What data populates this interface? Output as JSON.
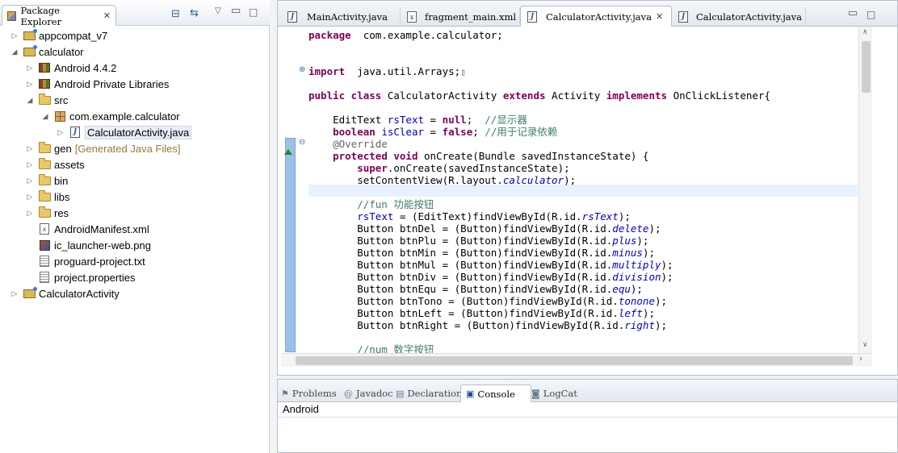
{
  "explorer": {
    "title": "Package Explorer",
    "tree": [
      {
        "label": "appcompat_v7",
        "icon": "project-icon",
        "arrow": "▷",
        "indent": 0
      },
      {
        "label": "calculator",
        "icon": "project-icon",
        "arrow": "◢",
        "indent": 0
      },
      {
        "label": "Android 4.4.2",
        "icon": "library-icon",
        "arrow": "▷",
        "indent": 1
      },
      {
        "label": "Android Private Libraries",
        "icon": "library-icon",
        "arrow": "▷",
        "indent": 1
      },
      {
        "label": "src",
        "icon": "src-folder-icon",
        "arrow": "◢",
        "indent": 1
      },
      {
        "label": "com.example.calculator",
        "icon": "package-icon",
        "arrow": "◢",
        "indent": 2
      },
      {
        "label": "CalculatorActivity.java",
        "icon": "java-file-icon",
        "arrow": "▷",
        "indent": 3,
        "selected": true
      },
      {
        "label": "gen",
        "suffix": "[Generated Java Files]",
        "icon": "folder-icon",
        "arrow": "▷",
        "indent": 1
      },
      {
        "label": "assets",
        "icon": "folder-icon",
        "arrow": "▷",
        "indent": 1
      },
      {
        "label": "bin",
        "icon": "folder-icon",
        "arrow": "▷",
        "indent": 1
      },
      {
        "label": "libs",
        "icon": "folder-icon",
        "arrow": "▷",
        "indent": 1
      },
      {
        "label": "res",
        "icon": "folder-icon",
        "arrow": "▷",
        "indent": 1
      },
      {
        "label": "AndroidManifest.xml",
        "icon": "xml-file-icon",
        "arrow": "",
        "indent": 1
      },
      {
        "label": "ic_launcher-web.png",
        "icon": "image-file-icon",
        "arrow": "",
        "indent": 1
      },
      {
        "label": "proguard-project.txt",
        "icon": "text-file-icon",
        "arrow": "",
        "indent": 1
      },
      {
        "label": "project.properties",
        "icon": "text-file-icon",
        "arrow": "",
        "indent": 1
      },
      {
        "label": "CalculatorActivity",
        "icon": "project-icon",
        "arrow": "▷",
        "indent": 0
      }
    ]
  },
  "editor": {
    "tabs": [
      {
        "label": "MainActivity.java",
        "icon": "java-file-icon"
      },
      {
        "label": "fragment_main.xml",
        "icon": "xml-file-icon"
      },
      {
        "label": "CalculatorActivity.java",
        "icon": "java-file-icon",
        "active": true
      },
      {
        "label": "CalculatorActivity.java",
        "icon": "java-file-icon"
      }
    ],
    "lines": [
      [
        [
          "kw",
          "package"
        ],
        [
          "",
          "  com.example.calculator;"
        ]
      ],
      [],
      [],
      [
        [
          "kw",
          "import"
        ],
        [
          "",
          "  java.util.Arrays;"
        ],
        [
          "box",
          "▯"
        ]
      ],
      [],
      [
        [
          "kw",
          "public class"
        ],
        [
          "",
          " CalculatorActivity "
        ],
        [
          "kw",
          "extends"
        ],
        [
          "",
          " Activity "
        ],
        [
          "kw",
          "implements"
        ],
        [
          "",
          " OnClickListener{"
        ]
      ],
      [],
      [
        [
          "",
          "    EditText "
        ],
        [
          "fld",
          "rsText"
        ],
        [
          "",
          " = "
        ],
        [
          "kw",
          "null"
        ],
        [
          "",
          ";  "
        ],
        [
          "cm",
          "//显示器"
        ]
      ],
      [
        [
          "",
          "    "
        ],
        [
          "kw",
          "boolean"
        ],
        [
          "",
          ""
        ],
        [
          "fld",
          " isClear"
        ],
        [
          "",
          " = "
        ],
        [
          "kw",
          "false"
        ],
        [
          "",
          "; "
        ],
        [
          "cm",
          "//用于记录依赖"
        ]
      ],
      [
        [
          "an",
          "    @Override"
        ]
      ],
      [
        [
          "",
          "    "
        ],
        [
          "kw",
          "protected void"
        ],
        [
          "",
          " onCreate(Bundle savedInstanceState) {"
        ]
      ],
      [
        [
          "",
          "        "
        ],
        [
          "kw",
          "super"
        ],
        [
          "",
          ".onCreate(savedInstanceState);"
        ]
      ],
      [
        [
          "",
          "        setContentView(R.layout."
        ],
        [
          "ifld",
          "calculator"
        ],
        [
          "",
          ");"
        ]
      ],
      [],
      [
        [
          "cm",
          "        //fun 功能按钮"
        ]
      ],
      [
        [
          "",
          "        "
        ],
        [
          "fld",
          "rsText"
        ],
        [
          "",
          " = (EditText)findViewById(R.id."
        ],
        [
          "ifld",
          "rsText"
        ],
        [
          "",
          ");"
        ]
      ],
      [
        [
          "",
          "        Button btnDel = (Button)findViewById(R.id."
        ],
        [
          "ifld",
          "delete"
        ],
        [
          "",
          ");"
        ]
      ],
      [
        [
          "",
          "        Button btnPlu = (Button)findViewById(R.id."
        ],
        [
          "ifld",
          "plus"
        ],
        [
          "",
          ");"
        ]
      ],
      [
        [
          "",
          "        Button btnMin = (Button)findViewById(R.id."
        ],
        [
          "ifld",
          "minus"
        ],
        [
          "",
          ");"
        ]
      ],
      [
        [
          "",
          "        Button btnMul = (Button)findViewById(R.id."
        ],
        [
          "ifld",
          "multiply"
        ],
        [
          "",
          ");"
        ]
      ],
      [
        [
          "",
          "        Button btnDiv = (Button)findViewById(R.id."
        ],
        [
          "ifld",
          "division"
        ],
        [
          "",
          ");"
        ]
      ],
      [
        [
          "",
          "        Button btnEqu = (Button)findViewById(R.id."
        ],
        [
          "ifld",
          "equ"
        ],
        [
          "",
          ");"
        ]
      ],
      [
        [
          "",
          "        Button btnTono = (Button)findViewById(R.id."
        ],
        [
          "ifld",
          "tonone"
        ],
        [
          "",
          ");"
        ]
      ],
      [
        [
          "",
          "        Button btnLeft = (Button)findViewById(R.id."
        ],
        [
          "ifld",
          "left"
        ],
        [
          "",
          ");"
        ]
      ],
      [
        [
          "",
          "        Button btnRight = (Button)findViewById(R.id."
        ],
        [
          "ifld",
          "right"
        ],
        [
          "",
          ");"
        ]
      ],
      [],
      [
        [
          "cm",
          "        //num 数字按钮"
        ]
      ]
    ]
  },
  "console": {
    "tabs": [
      {
        "label": "Problems",
        "icon": "problems-icon"
      },
      {
        "label": "Javadoc",
        "icon": "javadoc-icon"
      },
      {
        "label": "Declaration",
        "icon": "declaration-icon"
      },
      {
        "label": "Console",
        "icon": "console-icon",
        "active": true
      },
      {
        "label": "LogCat",
        "icon": "logcat-icon"
      }
    ],
    "output": "Android"
  },
  "colors": {
    "keyword": "#7f0055",
    "field": "#0000c0",
    "comment": "#3f7f5f",
    "annotation": "#646464"
  }
}
